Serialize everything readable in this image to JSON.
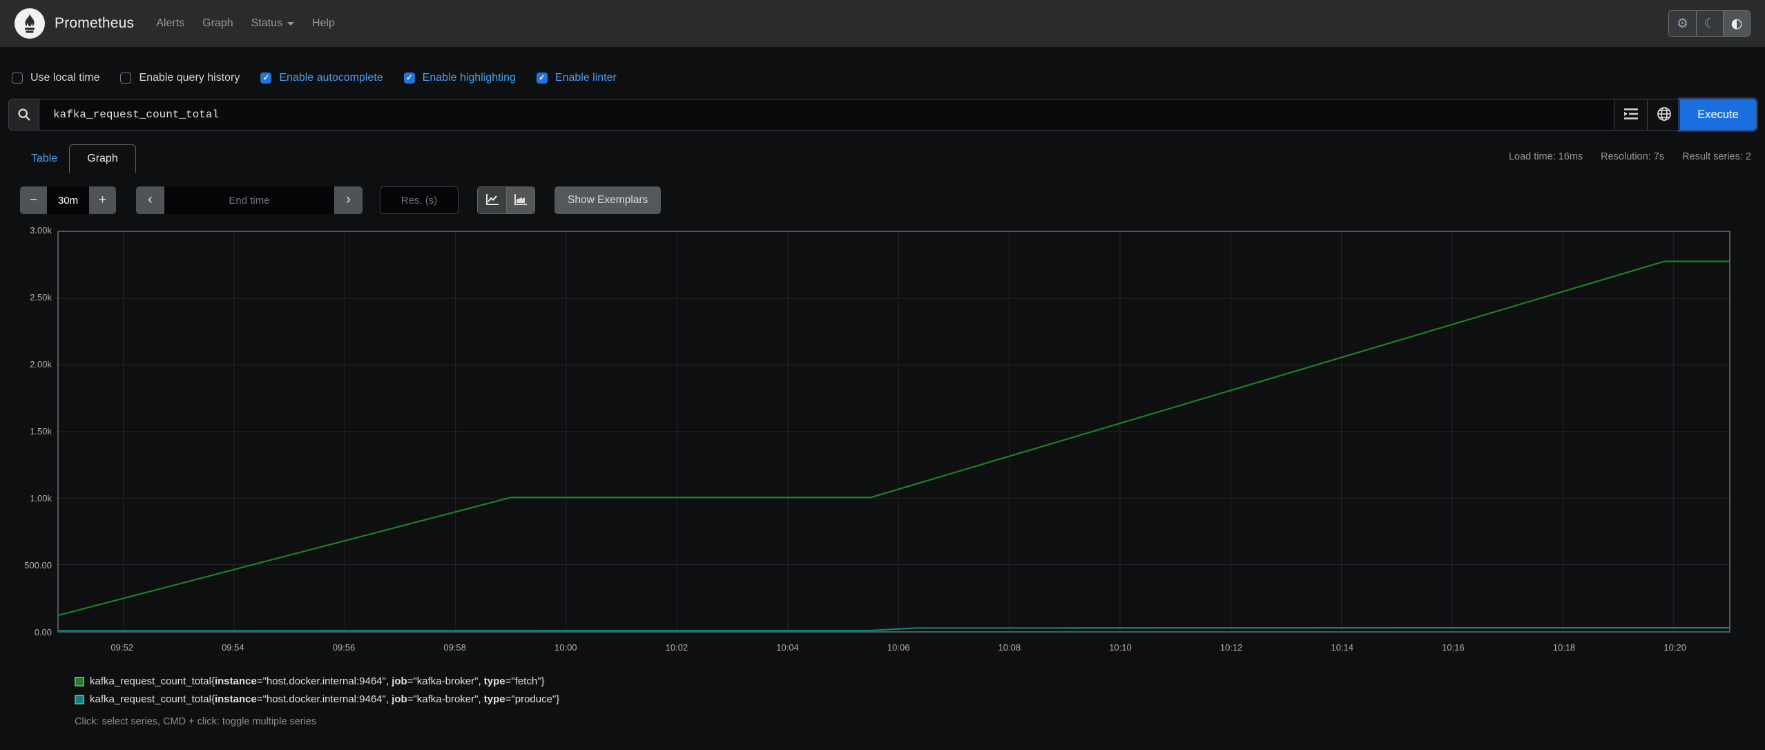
{
  "navbar": {
    "brand": "Prometheus",
    "links": [
      {
        "label": "Alerts",
        "caret": false
      },
      {
        "label": "Graph",
        "caret": false
      },
      {
        "label": "Status",
        "caret": true
      },
      {
        "label": "Help",
        "caret": false
      }
    ]
  },
  "theme": {
    "gear_icon": "⚙",
    "moon_icon": "☾",
    "contrast_icon": "◐"
  },
  "options": [
    {
      "label": "Use local time",
      "checked": false
    },
    {
      "label": "Enable query history",
      "checked": false
    },
    {
      "label": "Enable autocomplete",
      "checked": true
    },
    {
      "label": "Enable highlighting",
      "checked": true
    },
    {
      "label": "Enable linter",
      "checked": true
    }
  ],
  "query": {
    "expression": "kafka_request_count_total",
    "execute_label": "Execute"
  },
  "stats": {
    "load_time": "Load time: 16ms",
    "resolution": "Resolution: 7s",
    "result_series": "Result series: 2"
  },
  "tabs": {
    "table_label": "Table",
    "graph_label": "Graph"
  },
  "controls": {
    "range_decrease": "−",
    "range_value": "30m",
    "range_increase": "+",
    "back_arrow": "‹",
    "end_time_placeholder": "End time",
    "forward_arrow": "›",
    "resolution_placeholder": "Res. (s)",
    "show_exemplars_label": "Show Exemplars",
    "check_glyph": "✓"
  },
  "chart_data": {
    "type": "line",
    "title": "",
    "xlabel": "",
    "ylabel": "",
    "x_range": [
      "09:50:50",
      "10:21:00"
    ],
    "ylim": [
      0,
      3000
    ],
    "grid": true,
    "legend_position": "bottom",
    "x_ticks": [
      "09:52",
      "09:54",
      "09:56",
      "09:58",
      "10:00",
      "10:02",
      "10:04",
      "10:06",
      "10:08",
      "10:10",
      "10:12",
      "10:14",
      "10:16",
      "10:18",
      "10:20"
    ],
    "y_ticks": [
      "3.00k",
      "2.50k",
      "2.00k",
      "1.50k",
      "1.00k",
      "500.00",
      "0.00"
    ],
    "series": [
      {
        "name": "kafka_request_count_total{instance=\"host.docker.internal:9464\", job=\"kafka-broker\", type=\"fetch\"}",
        "color": "#1c8127",
        "points": [
          [
            "09:50:50",
            120
          ],
          [
            "09:59:00",
            1005
          ],
          [
            "10:05:30",
            1005
          ],
          [
            "10:19:50",
            2780
          ],
          [
            "10:21:00",
            2780
          ]
        ],
        "label_segments": [
          [
            "kafka_request_count_total{",
            0
          ],
          [
            "instance",
            1
          ],
          [
            "=\"host.docker.internal:9464\", ",
            0
          ],
          [
            "job",
            1
          ],
          [
            "=\"kafka-broker\", ",
            0
          ],
          [
            "type",
            1
          ],
          [
            "=\"fetch\"}",
            0
          ]
        ]
      },
      {
        "name": "kafka_request_count_total{instance=\"host.docker.internal:9464\", job=\"kafka-broker\", type=\"produce\"}",
        "color": "#10837e",
        "points": [
          [
            "09:50:50",
            3
          ],
          [
            "10:05:30",
            5
          ],
          [
            "10:06:20",
            24
          ],
          [
            "10:21:00",
            26
          ]
        ],
        "label_segments": [
          [
            "kafka_request_count_total{",
            0
          ],
          [
            "instance",
            1
          ],
          [
            "=\"host.docker.internal:9464\", ",
            0
          ],
          [
            "job",
            1
          ],
          [
            "=\"kafka-broker\", ",
            0
          ],
          [
            "type",
            1
          ],
          [
            "=\"produce\"}",
            0
          ]
        ]
      }
    ]
  },
  "legend_hint": "Click: select series, CMD + click: toggle multiple series",
  "colors": {
    "execute_blue": "#1a6ee0",
    "link_blue": "#4a9ef0",
    "checkbox_blue": "#2374dd",
    "grid": "#232528"
  }
}
